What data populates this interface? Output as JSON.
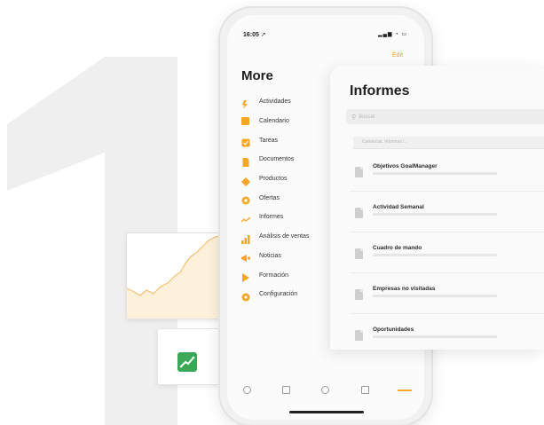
{
  "status": {
    "time": "16:05 ➚",
    "icons": "▂▄▆ ◔ ▭"
  },
  "header": {
    "edit": "Edit",
    "title": "More"
  },
  "menu": [
    {
      "label": "Actividades",
      "icon": "activity-icon"
    },
    {
      "label": "Calendario",
      "icon": "calendar-icon"
    },
    {
      "label": "Tareas",
      "icon": "tasks-icon"
    },
    {
      "label": "Documentos",
      "icon": "documents-icon"
    },
    {
      "label": "Productos",
      "icon": "products-icon"
    },
    {
      "label": "Ofertas",
      "icon": "offers-icon"
    },
    {
      "label": "Informes",
      "icon": "reports-icon"
    },
    {
      "label": "Análisis de ventas",
      "icon": "sales-analysis-icon"
    },
    {
      "label": "Noticias",
      "icon": "news-icon"
    },
    {
      "label": "Formación",
      "icon": "training-icon"
    },
    {
      "label": "Configuración",
      "icon": "settings-icon"
    }
  ],
  "informes": {
    "title": "Informes",
    "search_placeholder": "Buscar",
    "filter_chip": "Comercial, Informes i...",
    "reports": [
      {
        "title": "Objetivos GoalManager"
      },
      {
        "title": "Actividad Semanal"
      },
      {
        "title": "Cuadro de mando"
      },
      {
        "title": "Empresas no visitadas"
      },
      {
        "title": "Oportunidades"
      }
    ]
  },
  "colors": {
    "accent": "#f5a623",
    "app_green": "#3aa856",
    "digit_gray": "#efefef"
  }
}
